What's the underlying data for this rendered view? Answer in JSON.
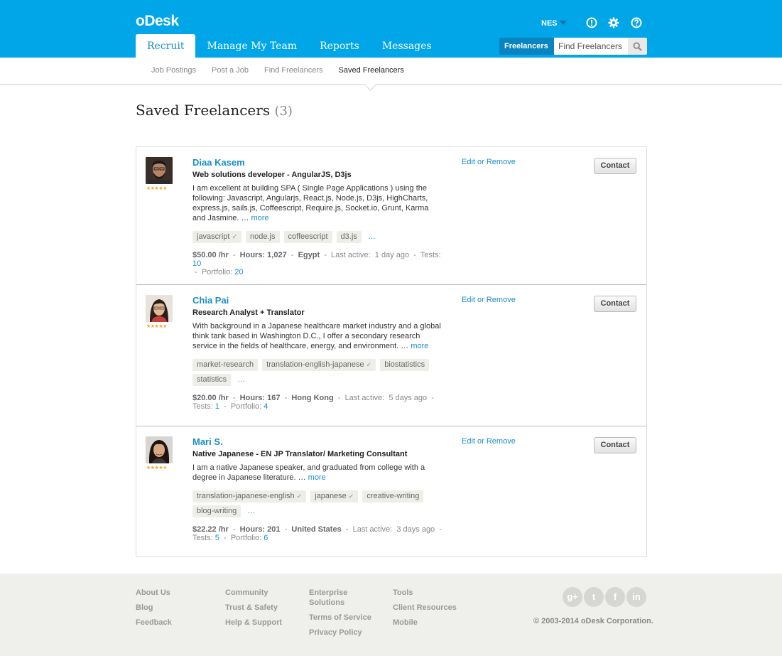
{
  "header": {
    "logo": "oDesk",
    "user_name": "NES",
    "tabs": [
      {
        "label": "Recruit"
      },
      {
        "label": "Manage My Team"
      },
      {
        "label": "Reports"
      },
      {
        "label": "Messages"
      }
    ],
    "search": {
      "scope": "Freelancers",
      "placeholder": "Find Freelancers"
    },
    "icons": [
      "alert-icon",
      "gear-icon",
      "help-icon",
      "search-icon"
    ]
  },
  "subnav": {
    "items": [
      {
        "label": "Job Postings"
      },
      {
        "label": "Post a Job"
      },
      {
        "label": "Find Freelancers"
      },
      {
        "label": "Saved Freelancers"
      }
    ],
    "active": "Saved Freelancers"
  },
  "page": {
    "title": "Saved Freelancers",
    "count": "(3)"
  },
  "freelancers": [
    {
      "name": "Diaa Kasem",
      "title": "Web solutions developer - AngularJS, D3js",
      "description": "I am excellent at building SPA ( Single Page Applications ) using the following: Javascript, Angularjs, React.js, Node.js, D3js, HighCharts, express.js, sails.js, Coffeescript, Require.js, Socket.io, Grunt, Karma and Jasmine. … ",
      "more": "more",
      "stars": "★★★★★",
      "skills": [
        "javascript",
        "node.js",
        "coffeescript",
        "d3.js"
      ],
      "skills_verified": [
        true,
        false,
        false,
        false
      ],
      "skills_more": "…",
      "rate": "$50.00 /hr",
      "hours": "Hours: 1,027",
      "country": "Egypt",
      "last_active_label": "Last active:",
      "last_active": "1 day ago",
      "tests_label": "Tests:",
      "tests": "10",
      "portfolio_label": "Portfolio:",
      "portfolio": "20",
      "edit_label": "Edit or Remove",
      "contact_label": "Contact"
    },
    {
      "name": "Chia Pai",
      "title": "Research Analyst + Translator",
      "description": "With background in a Japanese healthcare market industry and a global think tank based in Washington D.C., I offer a secondary research service in the fields of healthcare, energy, and environment. … ",
      "more": "more",
      "stars": "★★★★★",
      "skills": [
        "market-research",
        "translation-english-japanese",
        "biostatistics",
        "statistics"
      ],
      "skills_verified": [
        false,
        true,
        false,
        false
      ],
      "skills_more": "…",
      "rate": "$20.00 /hr",
      "hours": "Hours: 167",
      "country": "Hong Kong",
      "last_active_label": "Last active:",
      "last_active": "5 days ago",
      "tests_label": "Tests:",
      "tests": "1",
      "portfolio_label": "Portfolio:",
      "portfolio": "4",
      "edit_label": "Edit or Remove",
      "contact_label": "Contact"
    },
    {
      "name": "Mari S.",
      "title": "Native Japanese - EN JP Translator/ Marketing Consultant",
      "description": "I am a native Japanese speaker, and graduated from college with a degree in Japanese literature. … ",
      "more": "more",
      "stars": "★★★★★",
      "skills": [
        "translation-japanese-english",
        "japanese",
        "creative-writing",
        "blog-writing"
      ],
      "skills_verified": [
        true,
        true,
        false,
        false
      ],
      "skills_more": "…",
      "rate": "$22.22 /hr",
      "hours": "Hours: 201",
      "country": "United States",
      "last_active_label": "Last active:",
      "last_active": "3 days ago",
      "tests_label": "Tests:",
      "tests": "5",
      "portfolio_label": "Portfolio:",
      "portfolio": "6",
      "edit_label": "Edit or Remove",
      "contact_label": "Contact"
    }
  ],
  "footer": {
    "col1": [
      "About Us",
      "Blog",
      "Feedback"
    ],
    "col2": [
      "Community",
      "Trust & Safety",
      "Help & Support"
    ],
    "col3": [
      "Enterprise Solutions",
      "Terms of Service",
      "Privacy Policy"
    ],
    "col4": [
      "Tools",
      "Client Resources",
      "Mobile"
    ],
    "social": [
      {
        "icon": "google-plus-icon",
        "glyph": "g+"
      },
      {
        "icon": "twitter-icon",
        "glyph": "t"
      },
      {
        "icon": "facebook-icon",
        "glyph": "f"
      },
      {
        "icon": "linkedin-icon",
        "glyph": "in"
      }
    ],
    "copyright": "© 2003-2014 oDesk Corporation."
  },
  "colors": {
    "brand": "#00a6e8",
    "link": "#1a8ec7",
    "star": "#f5a623"
  }
}
